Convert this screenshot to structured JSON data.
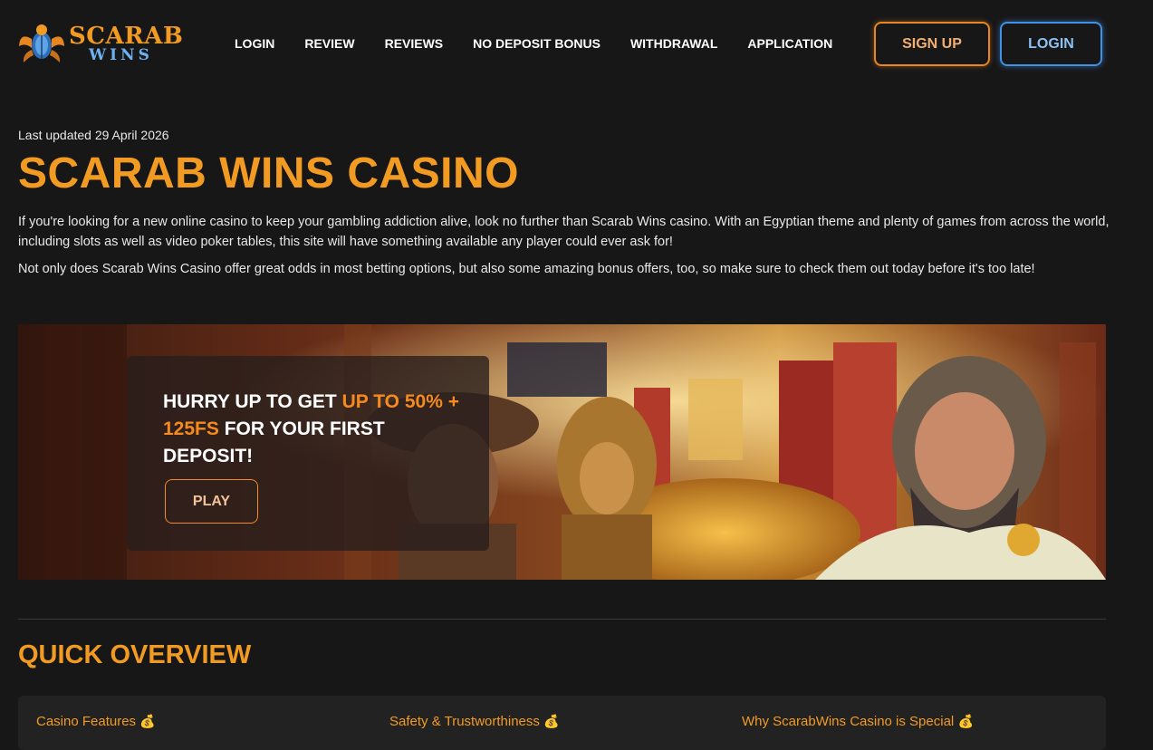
{
  "header": {
    "logo": {
      "top": "SCARAB",
      "bottom": "WINS"
    },
    "nav": [
      "LOGIN",
      "REVIEW",
      "REVIEWS",
      "NO DEPOSIT BONUS",
      "WITHDRAWAL",
      "APPLICATION"
    ],
    "signup_label": "SIGN UP",
    "login_label": "LOGIN"
  },
  "intro": {
    "updated": "Last updated 29 April 2026",
    "title": "SCARAB WINS CASINO",
    "p1": "If you're looking for a new online casino to keep your gambling addiction alive, look no further than Scarab Wins casino. With an Egyptian theme and plenty of games from across the world, including slots as well as video poker tables, this site will have something available any player could ever ask for!",
    "p2": "Not only does Scarab Wins Casino offer great odds in most betting options, but also some amazing bonus offers, too, so make sure to check them out today before it's too late!"
  },
  "banner": {
    "text_a": "HURRY UP TO GET ",
    "text_hl1": "UP TO 50%",
    "text_hl2": "+ 125FS",
    "text_b": " FOR YOUR FIRST DEPOSIT!",
    "play_label": "PLAY"
  },
  "overview": {
    "title": "QUICK OVERVIEW",
    "items": [
      "Casino Features",
      "Safety & Trustworthiness",
      "Why ScarabWins Casino is Special"
    ],
    "item_icon": "💰"
  },
  "colors": {
    "accent": "#f29b22",
    "login_blue": "#3f92e6",
    "background": "#181718"
  }
}
